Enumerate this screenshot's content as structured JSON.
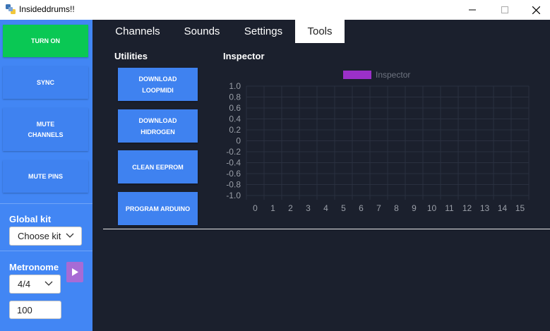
{
  "window": {
    "title": "Insideddrums!!"
  },
  "sidebar": {
    "buttons": {
      "turn_on": "TURN ON",
      "sync": "SYNC",
      "mute_channels": "MUTE CHANNELS",
      "mute_pins": "MUTE PINS"
    },
    "global_kit": {
      "label": "Global kit",
      "selected": "Choose kit"
    },
    "metronome": {
      "label": "Metronome",
      "time_signature": "4/4",
      "bpm": "100"
    }
  },
  "tabs": [
    {
      "label": "Channels",
      "active": false
    },
    {
      "label": "Sounds",
      "active": false
    },
    {
      "label": "Settings",
      "active": false
    },
    {
      "label": "Tools",
      "active": true
    }
  ],
  "utilities": {
    "title": "Utilities",
    "buttons": [
      "DOWNLOAD LOOPMIDI",
      "DOWNLOAD HIDROGEN",
      "CLEAN EEPROM",
      "PROGRAM ARDUINO"
    ]
  },
  "inspector": {
    "title": "Inspector"
  },
  "colors": {
    "sidebar": "#4286f4",
    "turn_on": "#0ac854",
    "background": "#1b202d",
    "series": "#9b30c8",
    "play_button": "#a76bd5"
  },
  "chart_data": {
    "type": "line",
    "series": [
      {
        "name": "Inspector",
        "color": "#9b30c8",
        "values": []
      }
    ],
    "x_ticks": [
      "0",
      "1",
      "2",
      "3",
      "4",
      "5",
      "6",
      "7",
      "8",
      "9",
      "10",
      "11",
      "12",
      "13",
      "14",
      "15"
    ],
    "y_ticks": [
      "1.0",
      "0.8",
      "0.6",
      "0.4",
      "0.2",
      "0",
      "-0.2",
      "-0.4",
      "-0.6",
      "-0.8",
      "-1.0"
    ],
    "ylim": [
      -1.0,
      1.0
    ],
    "xlim": [
      0,
      15
    ],
    "grid": true,
    "legend_position": "top-center"
  }
}
